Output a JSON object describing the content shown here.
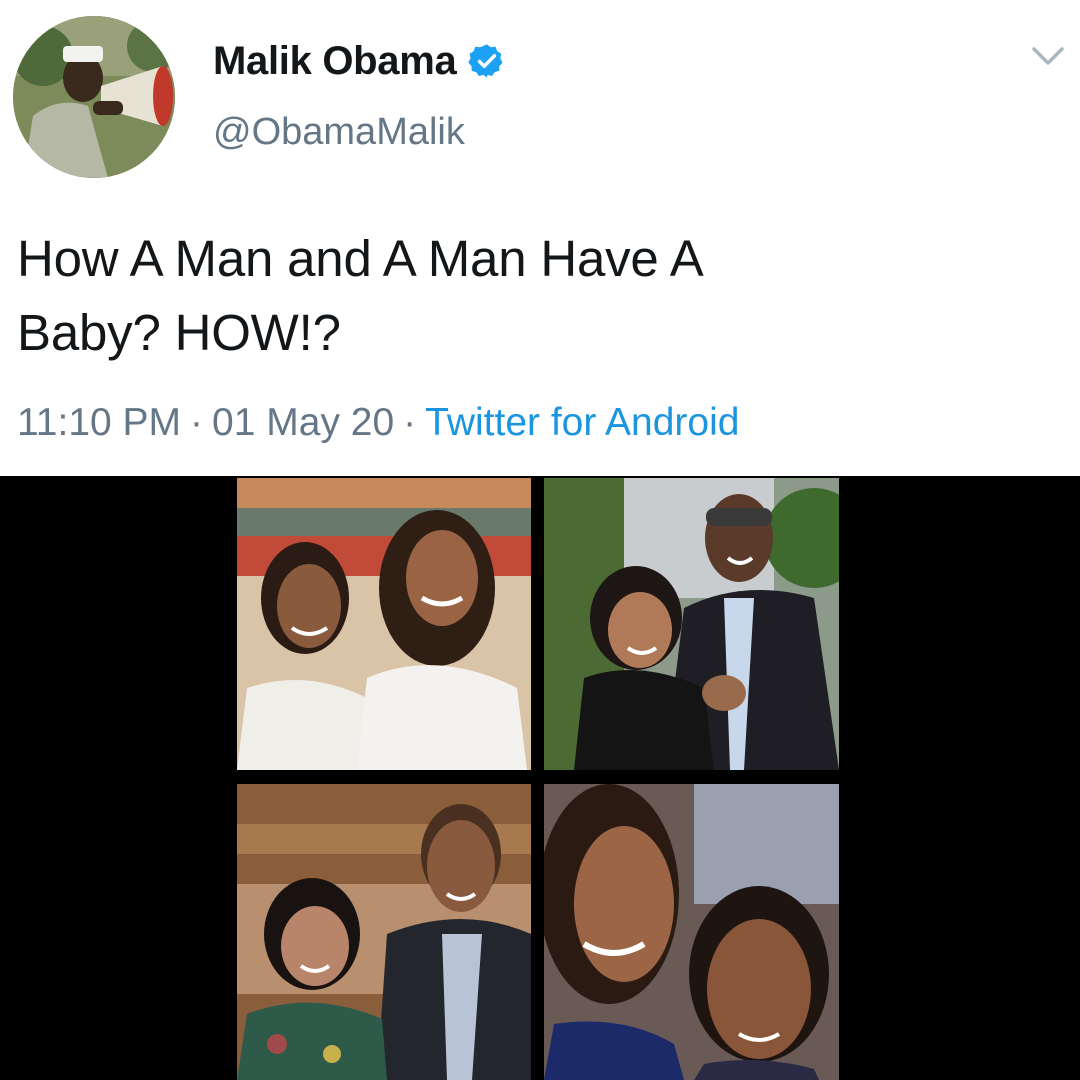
{
  "tweet": {
    "author": {
      "display_name": "Malik Obama",
      "handle": "@ObamaMalik",
      "verified": true
    },
    "text_line1": "How A Man and A Man Have A",
    "text_line2": "Baby? HOW!?",
    "time": "11:10 PM",
    "date": "01 May 20",
    "separator": "·",
    "source": "Twitter for Android",
    "menu_icon": "chevron-down-icon"
  },
  "media": {
    "photos": [
      {
        "name": "photo-top-left",
        "description_icon": "photo-two-girls"
      },
      {
        "name": "photo-top-right",
        "description_icon": "photo-couple"
      },
      {
        "name": "photo-bottom-left",
        "description_icon": "photo-couple"
      },
      {
        "name": "photo-bottom-right",
        "description_icon": "photo-two-girls"
      }
    ]
  },
  "colors": {
    "text_primary": "#14171a",
    "text_secondary": "#657786",
    "link": "#1b95e0",
    "verified_badge": "#1da1f2",
    "media_background": "#000000"
  }
}
